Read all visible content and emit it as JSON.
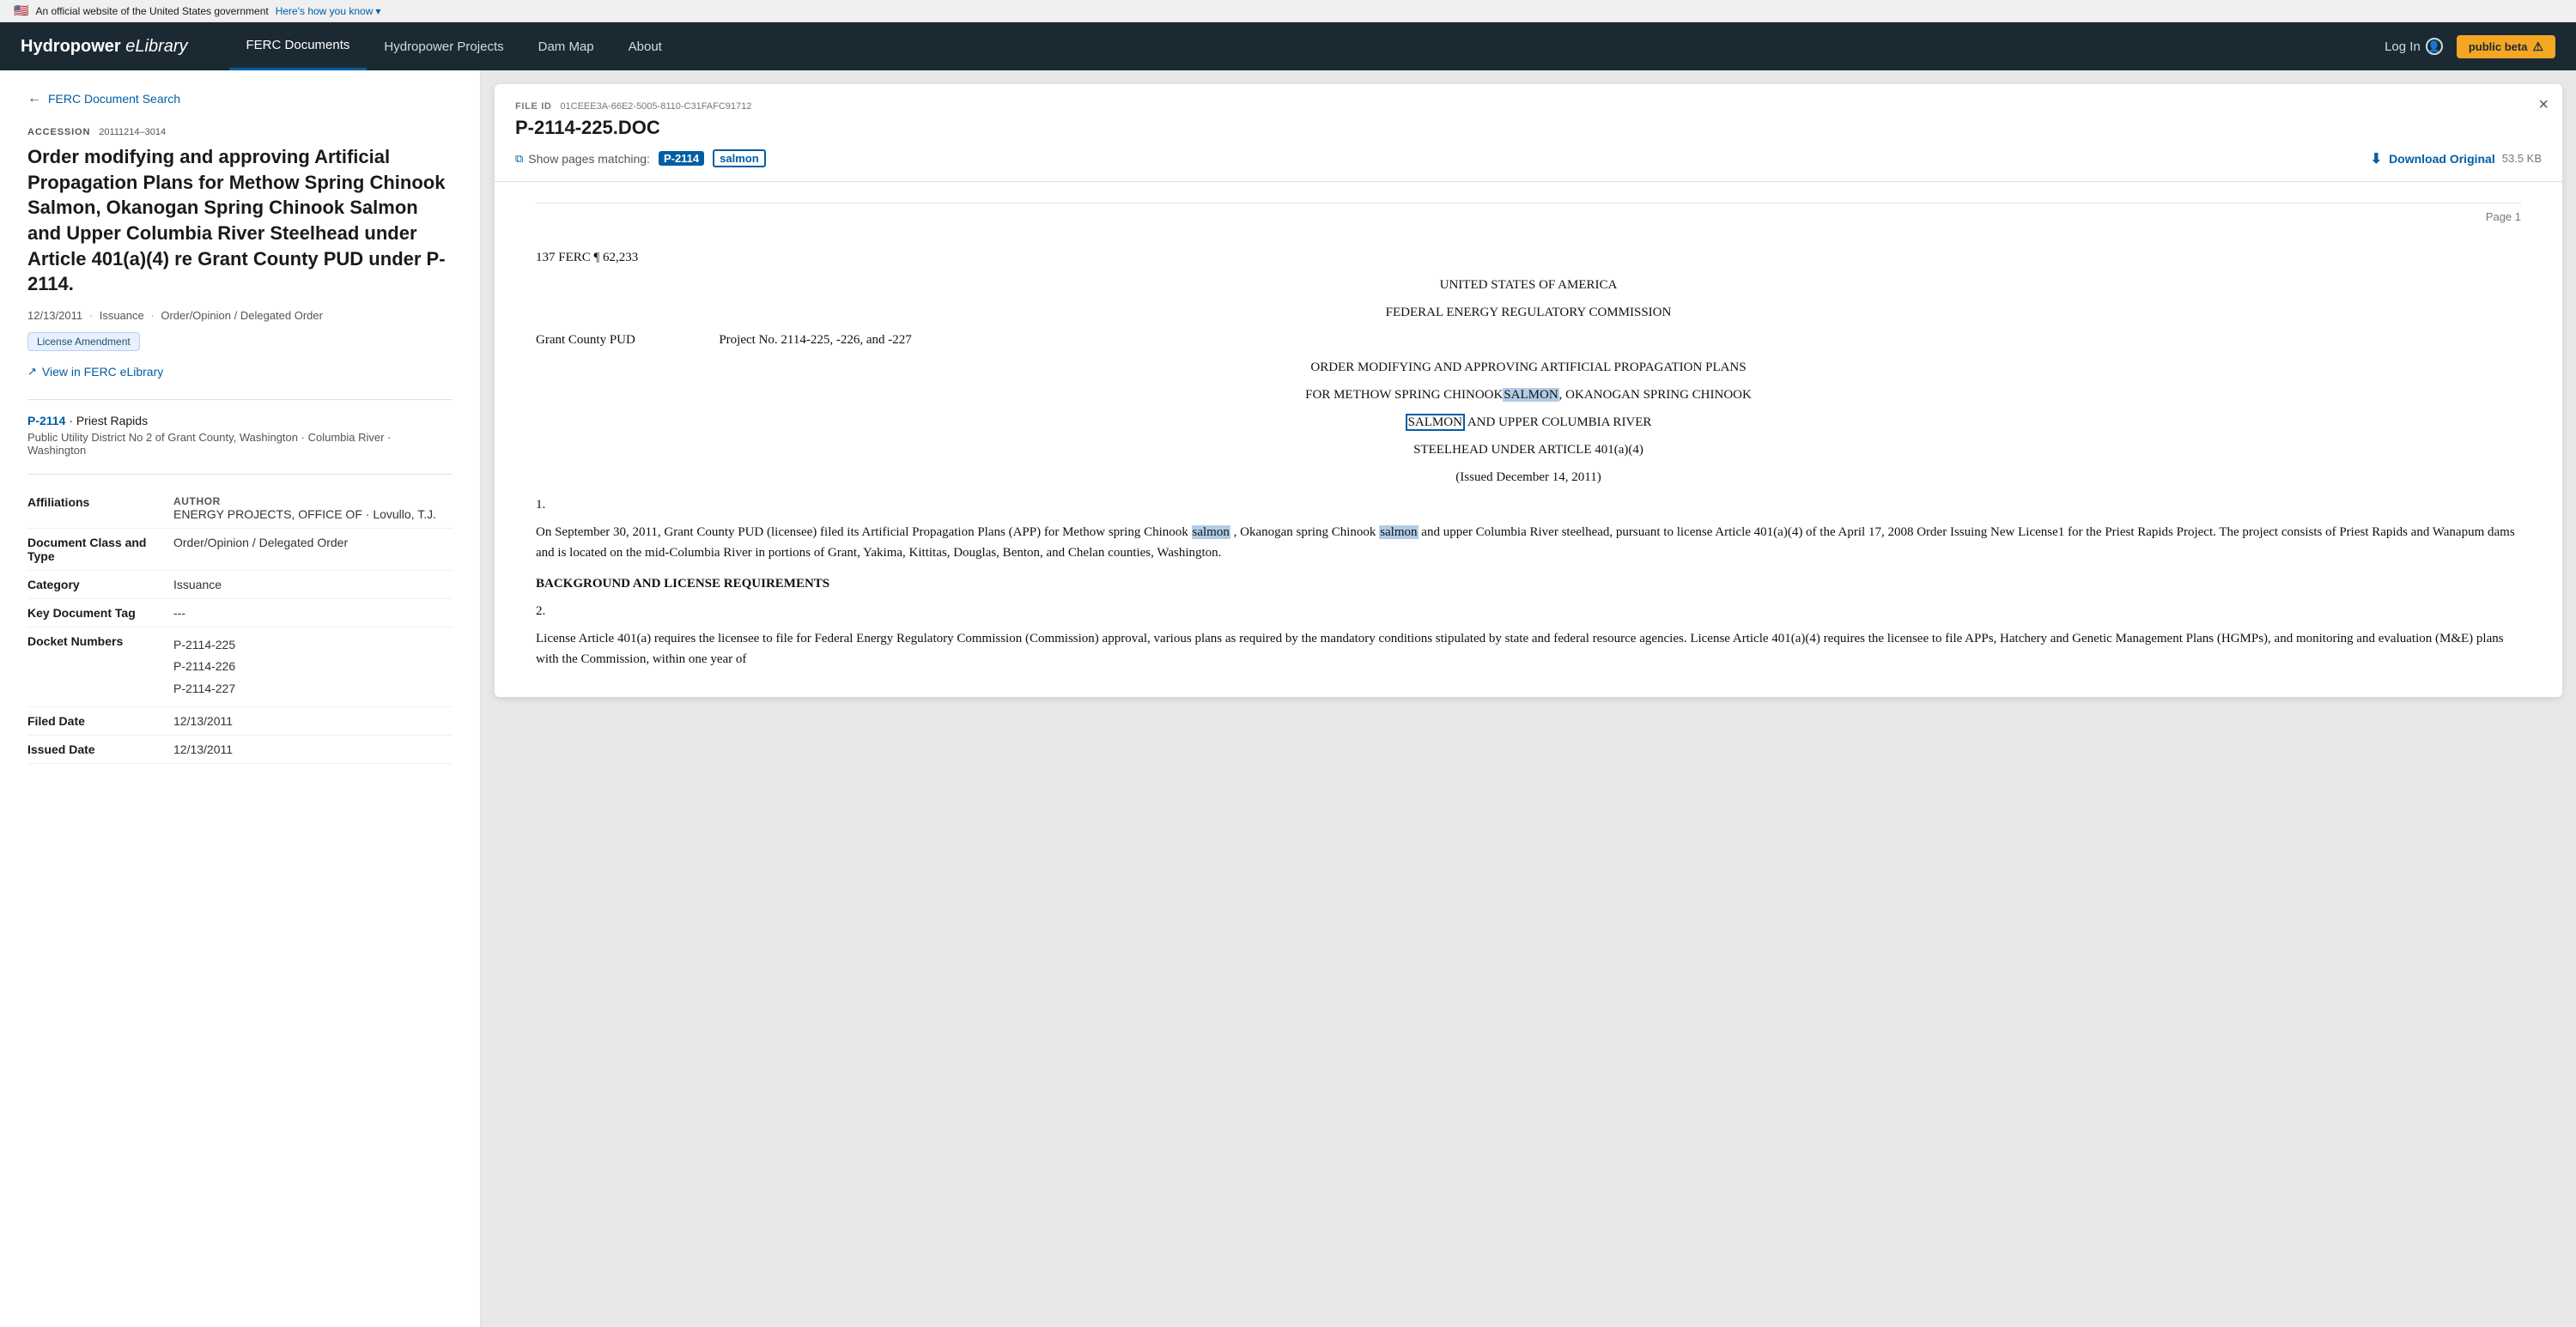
{
  "gov_banner": {
    "flag": "🇺🇸",
    "official_text": "An official website of the United States government",
    "how_link": "Here's how you know",
    "chevron": "▾"
  },
  "nav": {
    "logo": "Hydropower",
    "logo_italic": "eLibrary",
    "links": [
      {
        "id": "ferc-documents",
        "label": "FERC Documents",
        "active": true
      },
      {
        "id": "hydropower-projects",
        "label": "Hydropower Projects",
        "active": false
      },
      {
        "id": "dam-map",
        "label": "Dam Map",
        "active": false
      },
      {
        "id": "about",
        "label": "About",
        "active": false
      }
    ],
    "login_label": "Log In",
    "beta_label": "public beta",
    "beta_icon": "⚠"
  },
  "left_panel": {
    "back_label": "FERC Document Search",
    "accession_label": "ACCESSION",
    "accession_number": "20111214–3014",
    "doc_title": "Order modifying and approving Artificial Propagation Plans for Methow Spring Chinook Salmon, Okanogan Spring Chinook Salmon and Upper Columbia River Steelhead under Article 401(a)(4) re Grant County PUD under P-2114.",
    "date": "12/13/2011",
    "type": "Issuance",
    "category": "Order/Opinion / Delegated Order",
    "tag": "License Amendment",
    "view_ferc_label": "View in FERC eLibrary",
    "project_id": "P-2114",
    "project_name": "Priest Rapids",
    "project_utility": "Public Utility District No 2 of Grant County, Washington",
    "project_river": "Columbia River",
    "project_state": "Washington",
    "details": {
      "affiliations_label": "Affiliations",
      "affiliations_value": "AUTHOR",
      "affiliations_sub": "ENERGY PROJECTS, OFFICE OF · Lovullo, T.J.",
      "doc_class_label": "Document Class and Type",
      "doc_class_value": "Order/Opinion / Delegated Order",
      "category_label": "Category",
      "category_value": "Issuance",
      "key_tag_label": "Key Document Tag",
      "key_tag_value": "---",
      "docket_label": "Docket Numbers",
      "docket_1": "P-2114-225",
      "docket_2": "P-2114-226",
      "docket_3": "P-2114-227",
      "filed_label": "Filed Date",
      "filed_value": "12/13/2011",
      "issued_label": "Issued Date",
      "issued_value": "12/13/2011"
    }
  },
  "viewer": {
    "file_id_label": "FILE ID",
    "file_id_value": "01CEEE3A-66E2-5005-8110-C31FAFC91712",
    "filename": "P-2114-225.DOC",
    "show_pages_label": "Show pages matching:",
    "match1": "P-2114",
    "match2": "salmon",
    "download_label": "Download Original",
    "file_size": "53.5 KB",
    "close_icon": "×",
    "page_label": "Page 1",
    "doc_content": {
      "line1": "137 FERC ¶ 62,233",
      "line2": "UNITED STATES OF AMERICA",
      "line3": "FEDERAL ENERGY REGULATORY COMMISSION",
      "line4_left": "Grant County PUD",
      "line4_right": "Project No. 2114-225, -226, and -227",
      "line5": "ORDER MODIFYING AND APPROVING ARTIFICIAL PROPAGATION PLANS",
      "line6": "FOR METHOW SPRING CHINOOK",
      "line6_highlight": "SALMON",
      "line6_cont": ", OKANOGAN SPRING CHINOOK",
      "line7_highlight": "SALMON",
      "line7_cont": " AND UPPER COLUMBIA RIVER",
      "line8": "STEELHEAD UNDER ARTICLE 401(a)(4)",
      "line9": "(Issued December 14, 2011)",
      "para_num1": "1.",
      "para1": "On September 30, 2011, Grant County PUD (licensee) filed its Artificial Propagation Plans (APP) for Methow spring Chinook",
      "para1_h1": "salmon",
      "para1_cont1": ", Okanogan spring Chinook",
      "para1_h2": "salmon",
      "para1_cont2": " and upper Columbia River steelhead, pursuant to license Article 401(a)(4) of the April 17, 2008 Order Issuing New License1 for the Priest Rapids Project.  The project consists of Priest Rapids and Wanapum dams and is located on the mid-Columbia River in portions of Grant, Yakima, Kittitas, Douglas, Benton, and Chelan counties, Washington.",
      "bg_heading": "BACKGROUND AND LICENSE REQUIREMENTS",
      "para_num2": "2.",
      "para2": "License Article 401(a) requires the licensee to file for Federal Energy Regulatory Commission (Commission) approval, various plans as required by the mandatory conditions stipulated by state and federal resource agencies.  License Article 401(a)(4) requires the licensee to file APPs, Hatchery and Genetic Management Plans (HGMPs), and monitoring and evaluation (M&E) plans with the Commission, within one year of"
    }
  }
}
